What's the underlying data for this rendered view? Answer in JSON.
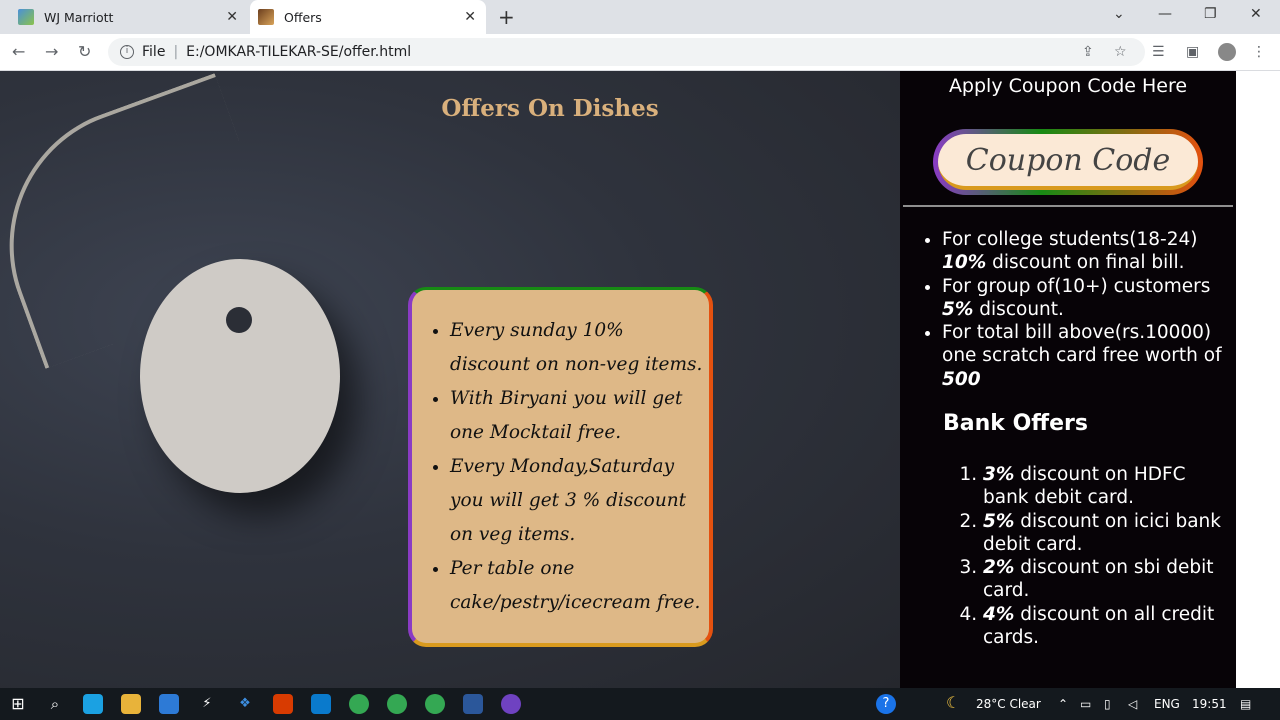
{
  "browser": {
    "tabs": [
      {
        "title": "WJ Marriott"
      },
      {
        "title": "Offers"
      }
    ],
    "address": {
      "scheme_label": "File",
      "path": "E:/OMKAR-TILEKAR-SE/offer.html"
    }
  },
  "page": {
    "heading": "Offers On Dishes",
    "offers": [
      "Every sunday 10% discount on non-veg items.",
      "With Biryani you will get one Mocktail free.",
      "Every Monday,Saturday you will get 3 % discount on veg items.",
      "Per table one cake/pestry/icecream free."
    ],
    "sidebar": {
      "apply_title": "Apply Coupon Code Here",
      "coupon_placeholder": "Coupon Code",
      "customer_offers": [
        {
          "prefix": "For college students(18-24) ",
          "bold": "10%",
          "suffix": " discount on final bill."
        },
        {
          "prefix": "For group of(10+) customers ",
          "bold": "5%",
          "suffix": " discount."
        },
        {
          "prefix": "For total bill above(rs.10000) one scratch card free worth of ",
          "bold": "500",
          "suffix": ""
        }
      ],
      "bank_title": "Bank Offers",
      "bank_offers": [
        {
          "bold": "3%",
          "text": " discount on HDFC bank debit card."
        },
        {
          "bold": "5%",
          "text": " discount on icici bank debit card."
        },
        {
          "bold": "2%",
          "text": " discount on sbi debit card."
        },
        {
          "bold": "4%",
          "text": " discount on all credit cards."
        }
      ]
    }
  },
  "taskbar": {
    "weather": "28°C  Clear",
    "language": "ENG",
    "time": "19:51"
  }
}
